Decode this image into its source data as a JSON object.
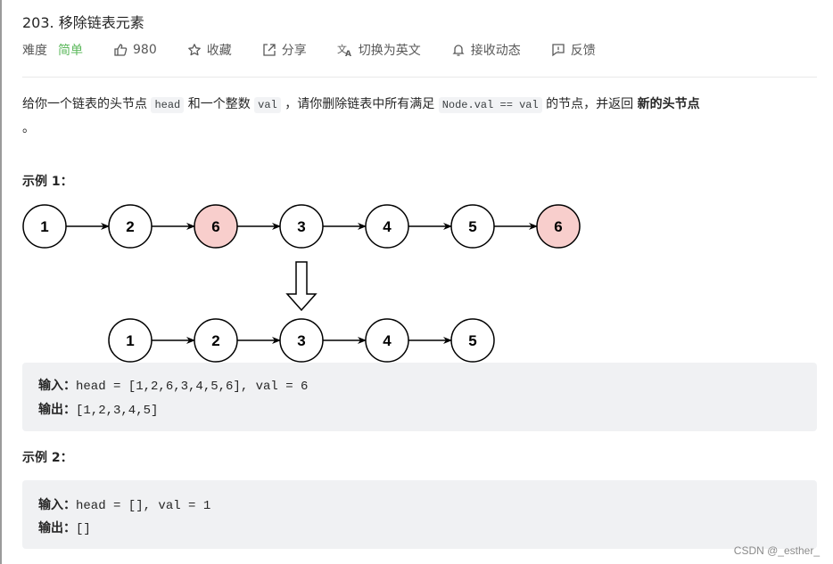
{
  "problem": {
    "title": "203. 移除链表元素",
    "difficulty_label": "难度",
    "difficulty": "简单",
    "difficulty_color": "#5cb85c",
    "likes": "980",
    "actions": [
      {
        "icon": "thumbs-up-icon",
        "label": "980"
      },
      {
        "icon": "star-icon",
        "label": "收藏"
      },
      {
        "icon": "share-icon",
        "label": "分享"
      },
      {
        "icon": "translate-icon",
        "label": "切换为英文"
      },
      {
        "icon": "bell-icon",
        "label": "接收动态"
      },
      {
        "icon": "feedback-icon",
        "label": "反馈"
      }
    ]
  },
  "description": {
    "p1": "给你一个链表的头节点 ",
    "code1": "head",
    "p2": " 和一个整数 ",
    "code2": "val",
    "p3": " ，请你删除链表中所有满足 ",
    "code3": "Node.val == val",
    "p4": " 的节点，并返回 ",
    "bold": "新的头节点",
    "p5": " 。"
  },
  "example1": {
    "title": "示例 1：",
    "diagram": {
      "before": [
        "1",
        "2",
        "6",
        "3",
        "4",
        "5",
        "6"
      ],
      "removed_value": "6",
      "after": [
        "1",
        "2",
        "3",
        "4",
        "5"
      ],
      "highlight_color": "#f8cecc"
    },
    "input_label": "输入：",
    "input": "head = [1,2,6,3,4,5,6], val = 6",
    "output_label": "输出：",
    "output": "[1,2,3,4,5]"
  },
  "example2": {
    "title": "示例 2：",
    "input_label": "输入：",
    "input": "head = [], val = 1",
    "output_label": "输出：",
    "output": "[]"
  },
  "watermark": "CSDN @_esther_"
}
